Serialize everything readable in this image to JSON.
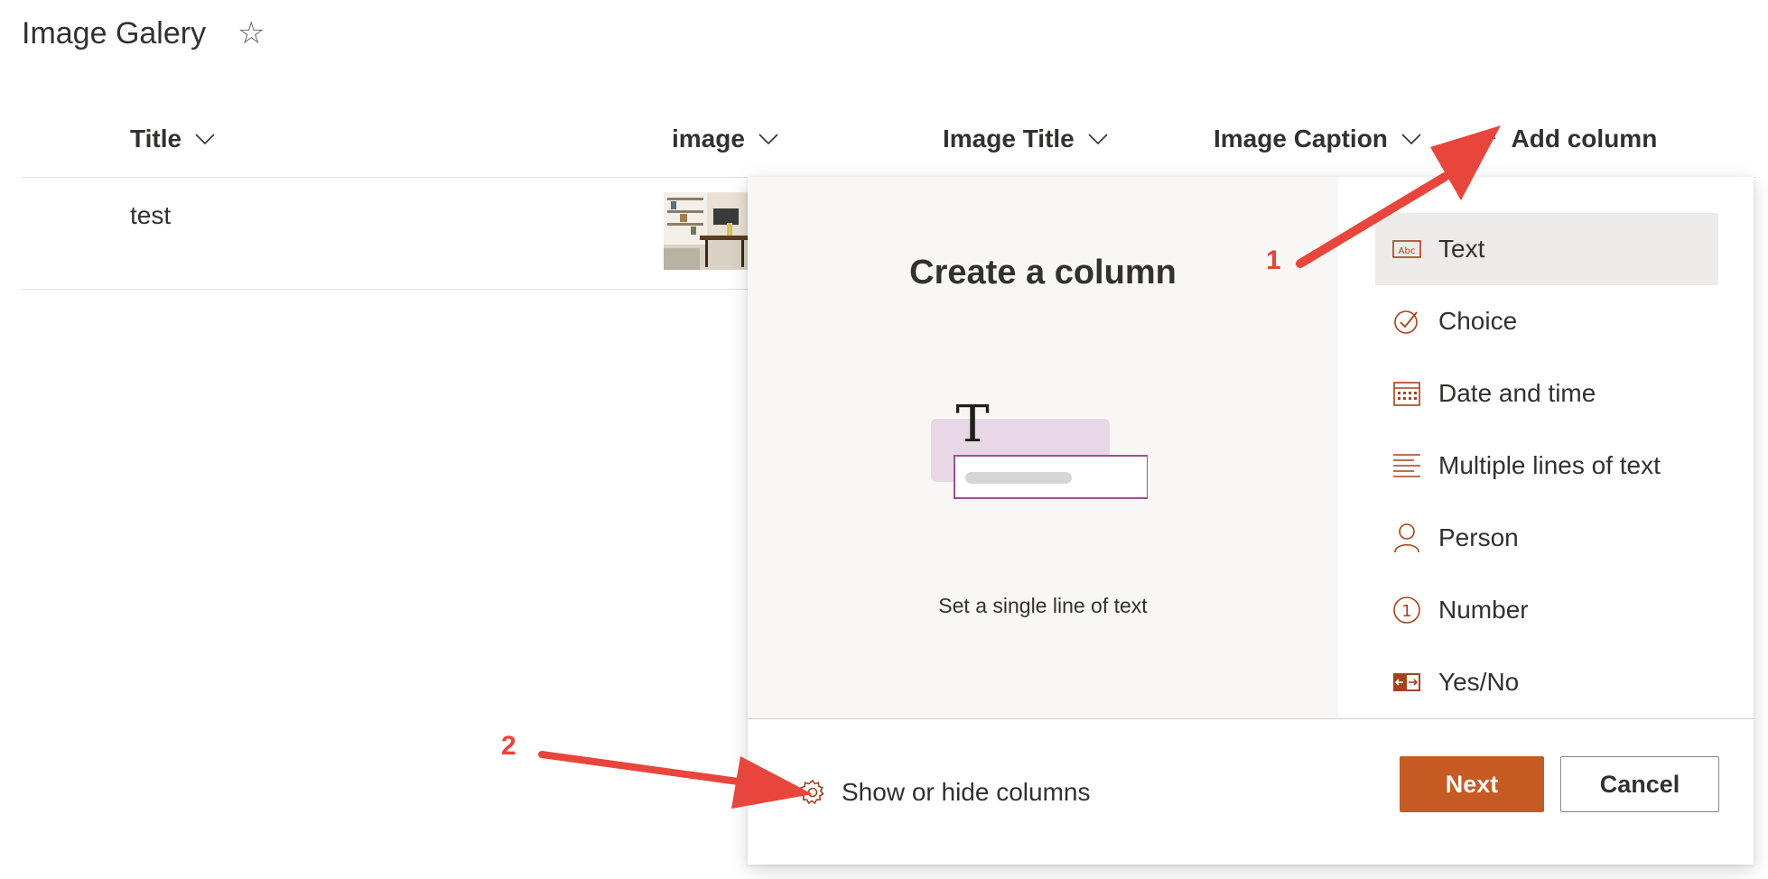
{
  "page": {
    "title": "Image Galery"
  },
  "table": {
    "columns": [
      "Title",
      "image",
      "Image Title",
      "Image Caption"
    ],
    "add_column_label": "Add column",
    "rows": [
      {
        "title": "test",
        "image": "thumbnail"
      }
    ]
  },
  "panel": {
    "title": "Create a column",
    "description": "Set a single line of text",
    "types": [
      {
        "label": "Text",
        "icon": "text-abc-icon",
        "selected": true
      },
      {
        "label": "Choice",
        "icon": "choice-check-icon",
        "selected": false
      },
      {
        "label": "Date and time",
        "icon": "calendar-icon",
        "selected": false
      },
      {
        "label": "Multiple lines of text",
        "icon": "multiline-text-icon",
        "selected": false
      },
      {
        "label": "Person",
        "icon": "person-icon",
        "selected": false
      },
      {
        "label": "Number",
        "icon": "number-icon",
        "selected": false
      },
      {
        "label": "Yes/No",
        "icon": "yes-no-icon",
        "selected": false
      }
    ],
    "show_hide_label": "Show or hide columns",
    "next_label": "Next",
    "cancel_label": "Cancel"
  },
  "annotations": [
    {
      "number": "1"
    },
    {
      "number": "2"
    }
  ],
  "colors": {
    "accent": "#c55a22",
    "annotation": "#e8453c",
    "selected_bg": "#edebe9"
  }
}
